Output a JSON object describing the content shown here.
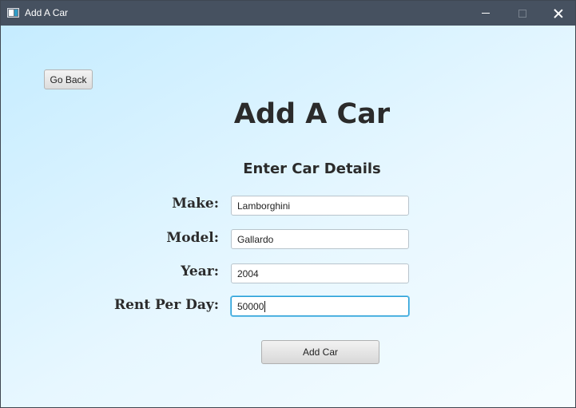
{
  "window": {
    "title": "Add A Car",
    "controls": [
      "minimize",
      "maximize",
      "close"
    ]
  },
  "nav": {
    "back_label": "Go Back"
  },
  "header": {
    "title": "Add A Car",
    "subtitle": "Enter Car Details"
  },
  "form": {
    "fields": [
      {
        "label": "Make:",
        "value": "Lamborghini"
      },
      {
        "label": "Model:",
        "value": "Gallardo"
      },
      {
        "label": "Year:",
        "value": "2004"
      },
      {
        "label": "Rent Per Day:",
        "value": "50000",
        "focused": true
      }
    ],
    "submit_label": "Add Car"
  },
  "colors": {
    "titlebar": "#465160",
    "focus_ring": "#2a9fd6",
    "background_start": "#c5ecff",
    "background_end": "#f5fcff"
  },
  "icons": {
    "app": "app-window-icon",
    "minimize": "minimize-icon",
    "maximize": "maximize-icon",
    "close": "close-icon"
  }
}
